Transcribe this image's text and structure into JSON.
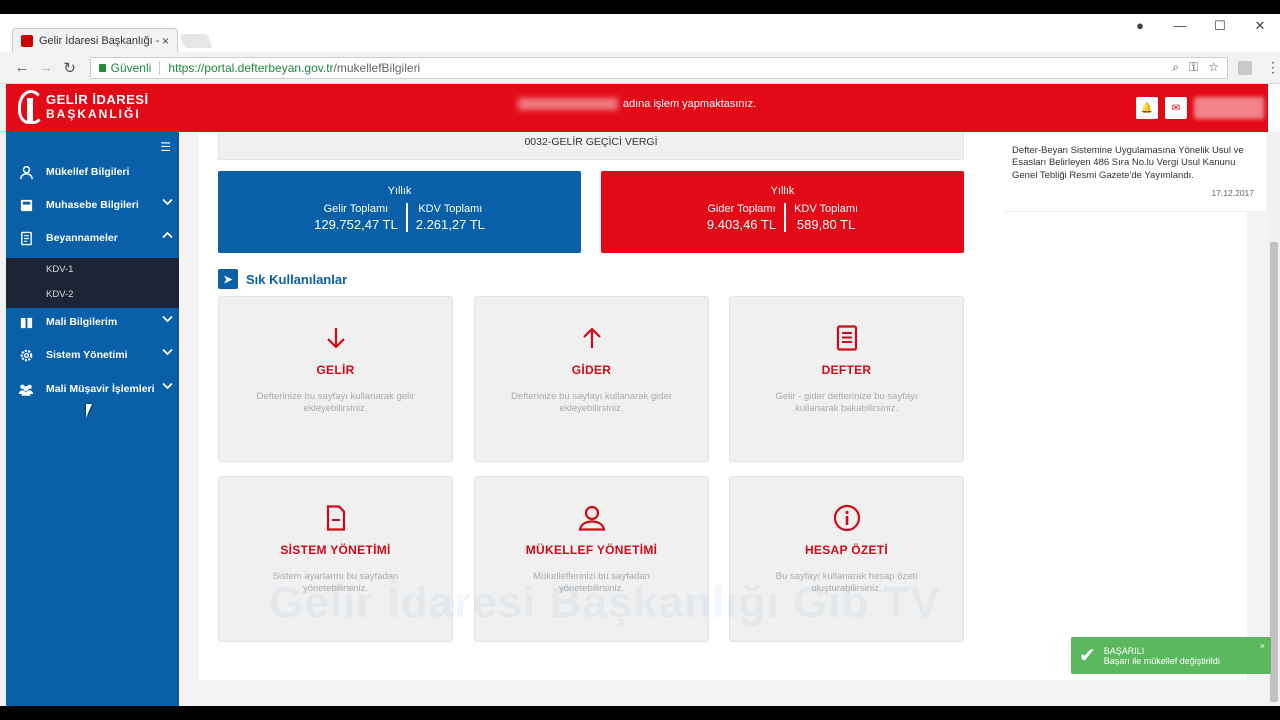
{
  "browser": {
    "tab_title": "Gelir İdaresi Başkanlığı -",
    "tab_close": "×",
    "secure_label": "Güvenli",
    "url_host": "https://portal.defterbeyan.gov.tr",
    "url_path": "/mukellefBilgileri",
    "win_min": "—",
    "win_max": "☐",
    "win_close": "✕"
  },
  "header": {
    "logo_line1": "GELİR İDARESİ",
    "logo_line2": "BAŞKANLIĞI",
    "message": "adına işlem yapmaktasınız.",
    "bell_icon": "🔔",
    "mail_icon": "✉"
  },
  "sidebar": {
    "items": [
      {
        "label": "Mükellef Bilgileri",
        "icon": "user-icon",
        "chevron": ""
      },
      {
        "label": "Muhasebe Bilgileri",
        "icon": "calculator-icon",
        "chevron": "⌄"
      },
      {
        "label": "Beyannameler",
        "icon": "document-icon",
        "chevron": "⌃"
      },
      {
        "label": "Mali Bilgilerim",
        "icon": "book-icon",
        "chevron": "⌄"
      },
      {
        "label": "Sistem Yönetimi",
        "icon": "gear-icon",
        "chevron": "⌄"
      },
      {
        "label": "Mali Müşavir İşlemleri",
        "icon": "users-icon",
        "chevron": "⌄"
      }
    ],
    "subitems": [
      "KDV-1",
      "KDV-2"
    ]
  },
  "main": {
    "tax_label": "0032-GELİR GEÇİCİ VERGİ",
    "gelir_card": {
      "period": "Yıllık",
      "left_label": "Gelir Toplamı",
      "left_value": "129.752,47 TL",
      "right_label": "KDV Toplamı",
      "right_value": "2.261,27 TL",
      "color": "#0960a8"
    },
    "gider_card": {
      "period": "Yıllık",
      "left_label": "Gider Toplamı",
      "left_value": "9.403,46 TL",
      "right_label": "KDV Toplamı",
      "right_value": "589,80 TL",
      "color": "#e30a17"
    },
    "frequent_title": "Sık Kullanılanlar",
    "quick_cards": [
      {
        "title": "GELİR",
        "desc": "Defterinize bu sayfayı kullanarak gelir ekleyebilirsiniz.",
        "icon": "arrow-down-icon"
      },
      {
        "title": "GİDER",
        "desc": "Defterinize bu sayfayı kullanarak gider ekleyebilirsiniz.",
        "icon": "arrow-up-icon"
      },
      {
        "title": "DEFTER",
        "desc": "Gelir - gider defterinize bu sayfayı kullanarak bakabilirsiniz.",
        "icon": "ledger-icon"
      },
      {
        "title": "SİSTEM YÖNETİMİ",
        "desc": "Sistem ayarlarını bu sayfadan yönetebilirsiniz.",
        "icon": "file-icon"
      },
      {
        "title": "MÜKELLEF YÖNETİMİ",
        "desc": "Mükelleflerinizi bu sayfadan yönetebilirsiniz.",
        "icon": "person-icon"
      },
      {
        "title": "HESAP ÖZETİ",
        "desc": "Bu sayfayı kullanarak hesap özeti oluşturabilirsiniz.",
        "icon": "info-icon"
      }
    ],
    "watermark": "Gelir İdaresi Başkanlığı Gib TV"
  },
  "news": {
    "text": "Defter-Beyan Sistemine Uygulamasına Yönelik Usul ve Esasları Belirleyen 486 Sıra No.lu Vergi Usul Kanunu Genel Tebliği Resmi Gazete'de Yayımlandı.",
    "date": "17.12.2017"
  },
  "toast": {
    "title": "BAŞARILI",
    "message": "Başarı ile mükellef değiştirildi",
    "close": "×",
    "color": "#5cb85c"
  }
}
